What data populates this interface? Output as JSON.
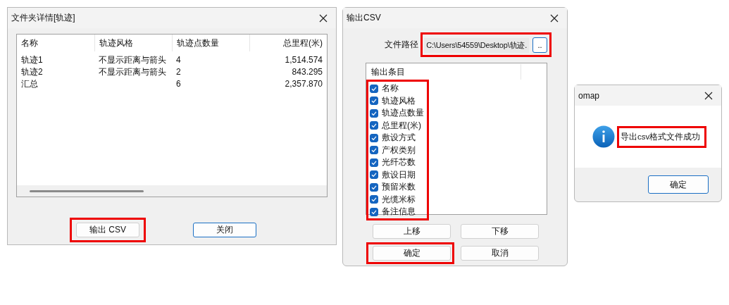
{
  "details_dialog": {
    "title": "文件夹详情[轨迹]",
    "columns": [
      "名称",
      "轨迹风格",
      "轨迹点数量",
      "总里程(米)"
    ],
    "rows": [
      [
        "轨迹1",
        "不显示距离与箭头",
        "4",
        "1,514.574"
      ],
      [
        "轨迹2",
        "不显示距离与箭头",
        "2",
        "843.295"
      ],
      [
        "汇总",
        "",
        "6",
        "2,357.870"
      ]
    ],
    "buttons": [
      {
        "label": "输出 CSV",
        "highlighted": true,
        "focused": false
      },
      {
        "label": "关闭",
        "highlighted": false,
        "focused": true
      }
    ]
  },
  "export_dialog": {
    "title": "输出CSV",
    "path_label": "文件路径",
    "path_value": "C:\\Users\\54559\\Desktop\\轨迹.",
    "browse_label": "..",
    "path_highlighted": true,
    "list_header": "输出条目",
    "list_highlighted": true,
    "items": [
      {
        "label": "名称",
        "checked": true
      },
      {
        "label": "轨迹风格",
        "checked": true
      },
      {
        "label": "轨迹点数量",
        "checked": true
      },
      {
        "label": "总里程(米)",
        "checked": true
      },
      {
        "label": "敷设方式",
        "checked": true
      },
      {
        "label": "产权类别",
        "checked": true
      },
      {
        "label": "光纤芯数",
        "checked": true
      },
      {
        "label": "敷设日期",
        "checked": true
      },
      {
        "label": "预留米数",
        "checked": true
      },
      {
        "label": "光缆米标",
        "checked": true
      },
      {
        "label": "备注信息",
        "checked": true
      }
    ],
    "buttons": [
      {
        "label": "上移",
        "highlighted": false
      },
      {
        "label": "下移",
        "highlighted": false
      },
      {
        "label": "确定",
        "highlighted": true
      },
      {
        "label": "取消",
        "highlighted": false
      }
    ]
  },
  "message_box": {
    "title": "omap",
    "message": "导出csv格式文件成功",
    "message_highlighted": true,
    "button": "确定"
  }
}
